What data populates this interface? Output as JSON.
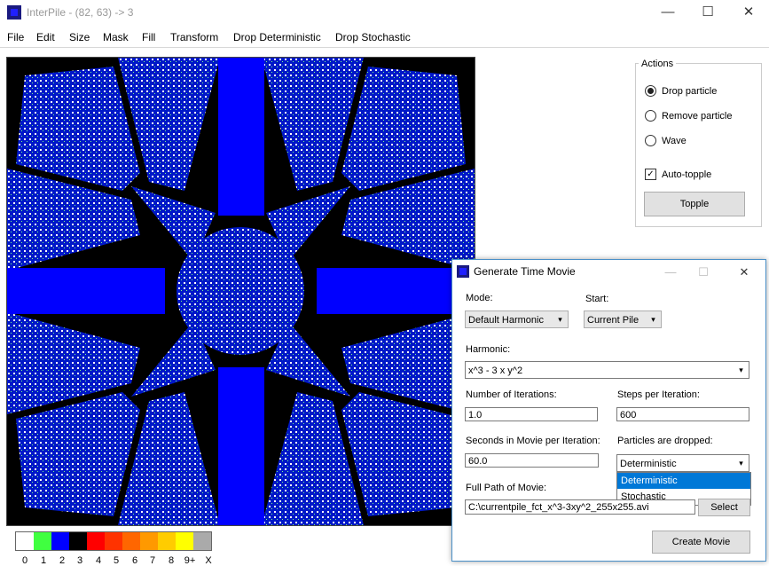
{
  "window": {
    "title": "InterPile - (82, 63) -> 3",
    "icon": "app-icon",
    "controls": {
      "minimize": "—",
      "maximize": "☐",
      "close": "✕"
    }
  },
  "menu": [
    "File",
    "Edit",
    "Size",
    "Mask",
    "Fill",
    "Transform",
    "Drop Deterministic",
    "Drop Stochastic"
  ],
  "palette": {
    "colors": [
      "#ffffff",
      "#40ff40",
      "#0000ff",
      "#000000",
      "#ff0000",
      "#ff3300",
      "#ff6600",
      "#ff9900",
      "#ffcc00",
      "#ffff00",
      "#aaaaaa"
    ],
    "labels": [
      "0",
      "1",
      "2",
      "3",
      "4",
      "5",
      "6",
      "7",
      "8",
      "9+",
      "X"
    ]
  },
  "actions": {
    "title": "Actions",
    "radio": [
      {
        "label": "Drop particle",
        "checked": true
      },
      {
        "label": "Remove particle",
        "checked": false
      },
      {
        "label": "Wave",
        "checked": false
      }
    ],
    "auto_topple": {
      "label": "Auto-topple",
      "checked": true,
      "mark": "✓"
    },
    "topple_button": "Topple"
  },
  "dialog": {
    "title": "Generate Time Movie",
    "controls": {
      "minimize": "—",
      "maximize": "☐",
      "close": "✕"
    },
    "mode_label": "Mode:",
    "mode_value": "Default Harmonic",
    "start_label": "Start:",
    "start_value": "Current Pile",
    "harmonic_label": "Harmonic:",
    "harmonic_value": "x^3 - 3 x y^2",
    "iterations_label": "Number of Iterations:",
    "iterations_value": "1.0",
    "steps_label": "Steps per Iteration:",
    "steps_value": "600",
    "seconds_label": "Seconds in Movie per Iteration:",
    "seconds_value": "60.0",
    "dropped_label": "Particles are dropped:",
    "dropped_value": "Deterministic",
    "dropped_options": [
      "Deterministic",
      "Stochastic"
    ],
    "path_label": "Full Path of Movie:",
    "path_value": "C:\\currentpile_fct_x^3-3xy^2_255x255.avi",
    "select_button": "Select",
    "create_button": "Create Movie",
    "arrow": "▾"
  }
}
